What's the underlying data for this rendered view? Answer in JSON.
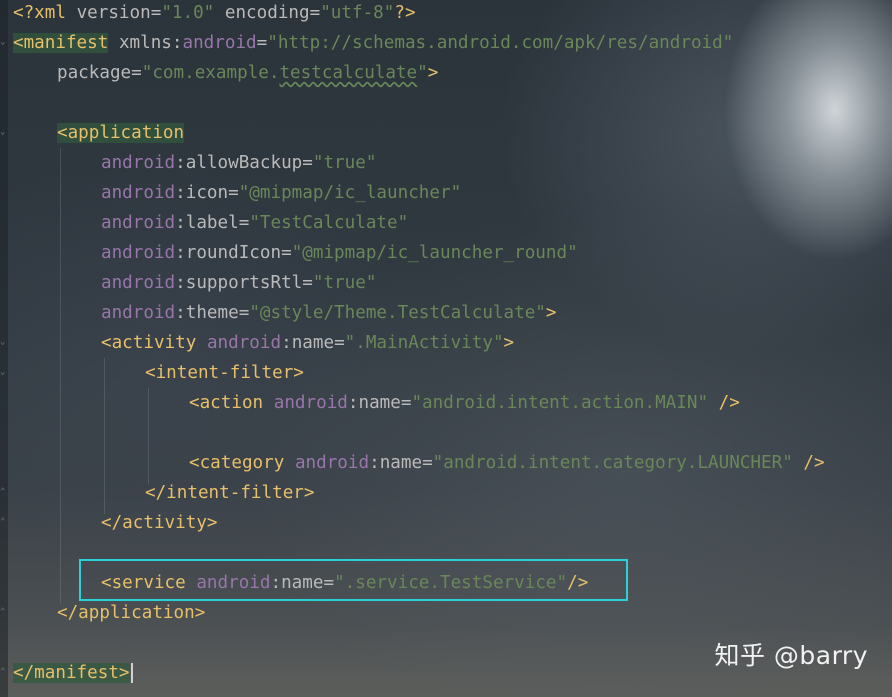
{
  "xml_declaration": {
    "text_open": "<?xml ",
    "version_attr": "version",
    "version_val": "\"1.0\"",
    "encoding_attr": "encoding",
    "encoding_val": "\"utf-8\"",
    "text_close": "?>"
  },
  "manifest": {
    "open_tag": "<manifest",
    "xmlns_attr": "xmlns:",
    "xmlns_ns": "android",
    "xmlns_val": "\"http://schemas.android.com/apk/res/android\"",
    "package_attr": "package",
    "package_val_prefix": "\"com.example.",
    "package_val_word": "testcalculate",
    "package_val_suffix": "\"",
    "close_bracket": ">",
    "end_tag": "</manifest>"
  },
  "application": {
    "open_tag": "<application",
    "attrs": [
      {
        "ns": "android",
        "name": "allowBackup",
        "value": "\"true\""
      },
      {
        "ns": "android",
        "name": "icon",
        "value": "\"@mipmap/ic_launcher\""
      },
      {
        "ns": "android",
        "name": "label",
        "value": "\"TestCalculate\""
      },
      {
        "ns": "android",
        "name": "roundIcon",
        "value": "\"@mipmap/ic_launcher_round\""
      },
      {
        "ns": "android",
        "name": "supportsRtl",
        "value": "\"true\""
      },
      {
        "ns": "android",
        "name": "theme",
        "value": "\"@style/Theme.TestCalculate\""
      }
    ],
    "close_bracket": ">",
    "end_tag": "</application>"
  },
  "activity": {
    "open_tag": "<activity ",
    "ns": "android",
    "attr": "name",
    "value": "\".MainActivity\"",
    "close_bracket": ">",
    "end_tag": "</activity>"
  },
  "intent_filter": {
    "open_tag": "<intent-filter>",
    "end_tag": "</intent-filter>"
  },
  "action": {
    "open_tag": "<action ",
    "ns": "android",
    "attr": "name",
    "value": "\"android.intent.action.MAIN\"",
    "close": " />"
  },
  "category": {
    "open_tag": "<category ",
    "ns": "android",
    "attr": "name",
    "value": "\"android.intent.category.LAUNCHER\"",
    "close": " />"
  },
  "service": {
    "open_tag": "<service ",
    "ns": "android",
    "attr": "name",
    "value": "\".service.TestService\"",
    "close": "/>"
  },
  "colon": ":",
  "equals": "=",
  "watermark": "知乎 @barry",
  "colors": {
    "tag": "#e8bf6a",
    "namespace": "#9876aa",
    "value": "#6a8759",
    "highlight_box": "#2ad1d6"
  }
}
